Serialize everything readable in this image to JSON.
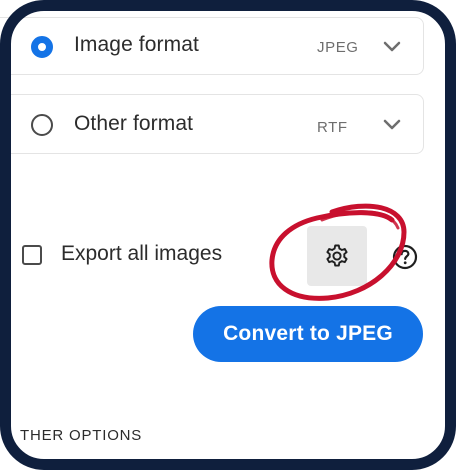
{
  "formats": [
    {
      "label": "Image format",
      "value": "JPEG",
      "selected": true
    },
    {
      "label": "Other format",
      "value": "RTF",
      "selected": false
    }
  ],
  "export_images": {
    "label": "Export all images",
    "checked": false
  },
  "settings": {
    "icon": "gear-icon"
  },
  "help": {
    "icon": "help-icon"
  },
  "convert": {
    "label": "Convert to JPEG"
  },
  "section": {
    "other_options_label": "THER OPTIONS"
  },
  "colors": {
    "accent": "#1473e6",
    "frame": "#0f1f3d",
    "highlight": "#c8102e"
  }
}
